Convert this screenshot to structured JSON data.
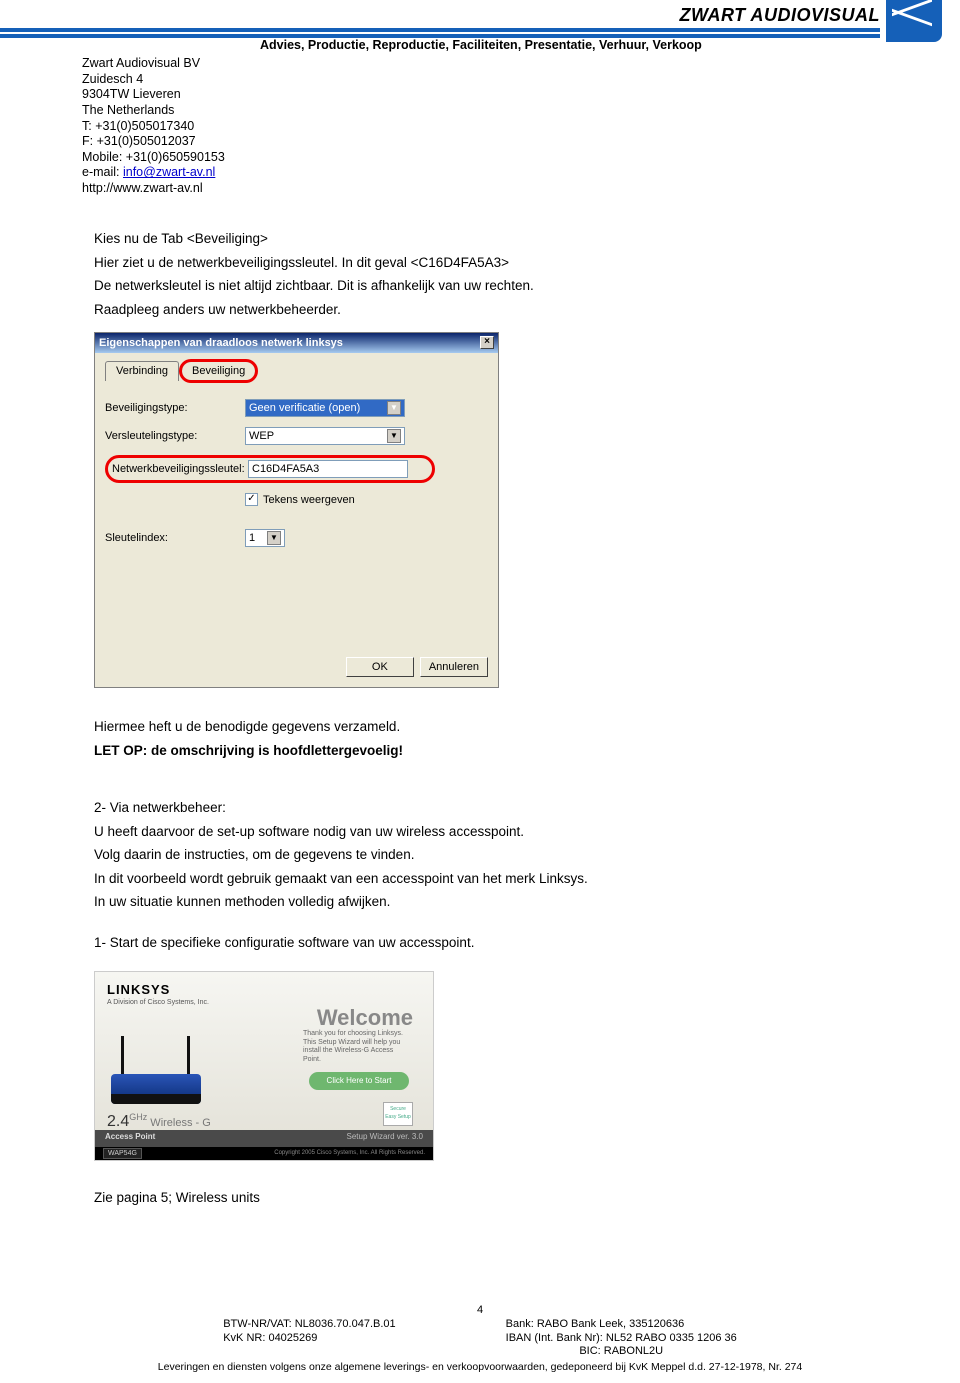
{
  "brand": {
    "name": "ZWART AUDIOVISUAL",
    "tagline": "Advies, Productie, Reproductie, Faciliteiten, Presentatie, Verhuur, Verkoop"
  },
  "company": {
    "name": "Zwart Audiovisual BV",
    "addr1": "Zuidesch 4",
    "addr2": "9304TW Lieveren",
    "country": "The Netherlands",
    "tel": "T: +31(0)505017340",
    "fax": "F: +31(0)505012037",
    "mobile": "Mobile: +31(0)650590153",
    "email_label": "e-mail: ",
    "email": "info@zwart-av.nl",
    "web": "http://www.zwart-av.nl"
  },
  "body": {
    "p1": "Kies nu de Tab <Beveiliging>",
    "p2": "Hier ziet u de netwerkbeveiligingssleutel. In dit geval <C16D4FA5A3>",
    "p3": "De netwerksleutel is niet altijd zichtbaar. Dit is afhankelijk van uw rechten.",
    "p4": "Raadpleeg anders uw netwerkbeheerder.",
    "p5": "Hiermee heft u de benodigde gegevens verzameld.",
    "p6": "LET OP: de omschrijving is hoofdlettergevoelig!",
    "s2_head": "2-  Via netwerkbeheer:",
    "s2_1": "U heeft daarvoor de set-up software nodig van uw wireless accesspoint.",
    "s2_2": "Volg daarin de instructies, om de gegevens te vinden.",
    "s2_3": "In dit voorbeeld wordt gebruik gemaakt van  een accesspoint van het merk Linksys.",
    "s2_4": "In uw situatie kunnen methoden volledig afwijken.",
    "s2_5": "1-  Start de specifieke configuratie software van uw accesspoint.",
    "zie": "Zie pagina 5; Wireless units"
  },
  "dialog": {
    "title": "Eigenschappen van draadloos netwerk linksys",
    "tab1": "Verbinding",
    "tab2": "Beveiliging",
    "lbl_type": "Beveiligingstype:",
    "lbl_enc": "Versleutelingstype:",
    "lbl_key": "Netwerkbeveiligingssleutel:",
    "lbl_chk": "Tekens weergeven",
    "lbl_idx": "Sleutelindex:",
    "val_type": "Geen verificatie (open)",
    "val_enc": "WEP",
    "val_key": "C16D4FA5A3",
    "val_idx": "1",
    "btn_ok": "OK",
    "btn_cancel": "Annuleren",
    "close": "×"
  },
  "linksys": {
    "logo": "LINKSYS",
    "sub": "A Division of Cisco Systems, Inc.",
    "welcome": "Welcome",
    "copy": "Thank you for choosing Linksys. This Setup Wizard will help you install the Wireless-G Access Point.",
    "btn": "Click Here to Start",
    "seal": "Secure Easy Setup",
    "ghz_num": "2.4",
    "ghz_sup": "GHz",
    "ghz_rest": " Wireless - G",
    "bar_left": "Access Point",
    "bar_right": "Setup Wizard ver. 3.0",
    "model": "WAP54G",
    "copyright": "Copyright 2005 Cisco Systems, Inc. All Rights Reserved."
  },
  "footer": {
    "page": "4",
    "l1": "BTW-NR/VAT: NL8036.70.047.B.01",
    "l2": "KvK NR: 04025269",
    "r1": "Bank: RABO Bank Leek, 335120636",
    "r2": "IBAN (Int. Bank Nr): NL52 RABO 0335 1206 36",
    "r3": "BIC: RABONL2U",
    "bottom": "Leveringen en diensten volgens onze algemene leverings- en verkoopvoorwaarden, gedeponeerd bij KvK Meppel d.d. 27-12-1978, Nr. 274"
  }
}
